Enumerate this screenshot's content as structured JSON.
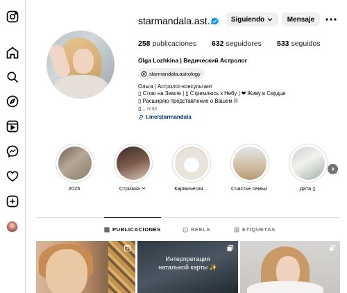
{
  "profile": {
    "username": "starmandala.ast...",
    "buttons": {
      "following": "Siguiendo",
      "message": "Mensaje"
    },
    "stats": {
      "posts_count": "258",
      "posts_label": "publicaciones",
      "followers_count": "632",
      "followers_label": "seguidores",
      "following_count": "533",
      "following_label": "seguidos"
    },
    "full_name": "Olga Lozhkina | Ведический Астролог",
    "threads_handle": "starmandala.astrology",
    "bio": [
      "Ольга | Астролог-консультант",
      "▯ Стою на Земле | ▯ Стремлюсь к Небу | ❤ Живу в Сердце",
      "▯ Расширяю представление о Вашем Я",
      "▯..."
    ],
    "bio_more": "más",
    "link": "t.me/starmandala"
  },
  "highlights": [
    {
      "label": "2025"
    },
    {
      "label": "Стрижка ✂"
    },
    {
      "label": "Кармически..."
    },
    {
      "label": "Счастье семьи"
    },
    {
      "label": "Дата ▯"
    }
  ],
  "tabs": {
    "posts": "PUBLICACIONES",
    "reels": "REELS",
    "tagged": "ETIQUETAS"
  },
  "posts": [
    {
      "text": ""
    },
    {
      "text_line1": "Интерпретация",
      "text_line2": "натальной карты ✨"
    },
    {
      "text": ""
    }
  ],
  "colors": {
    "verified": "#0095f6",
    "link": "#00376b",
    "button_bg": "#efefef",
    "divider": "#dbdbdb"
  }
}
